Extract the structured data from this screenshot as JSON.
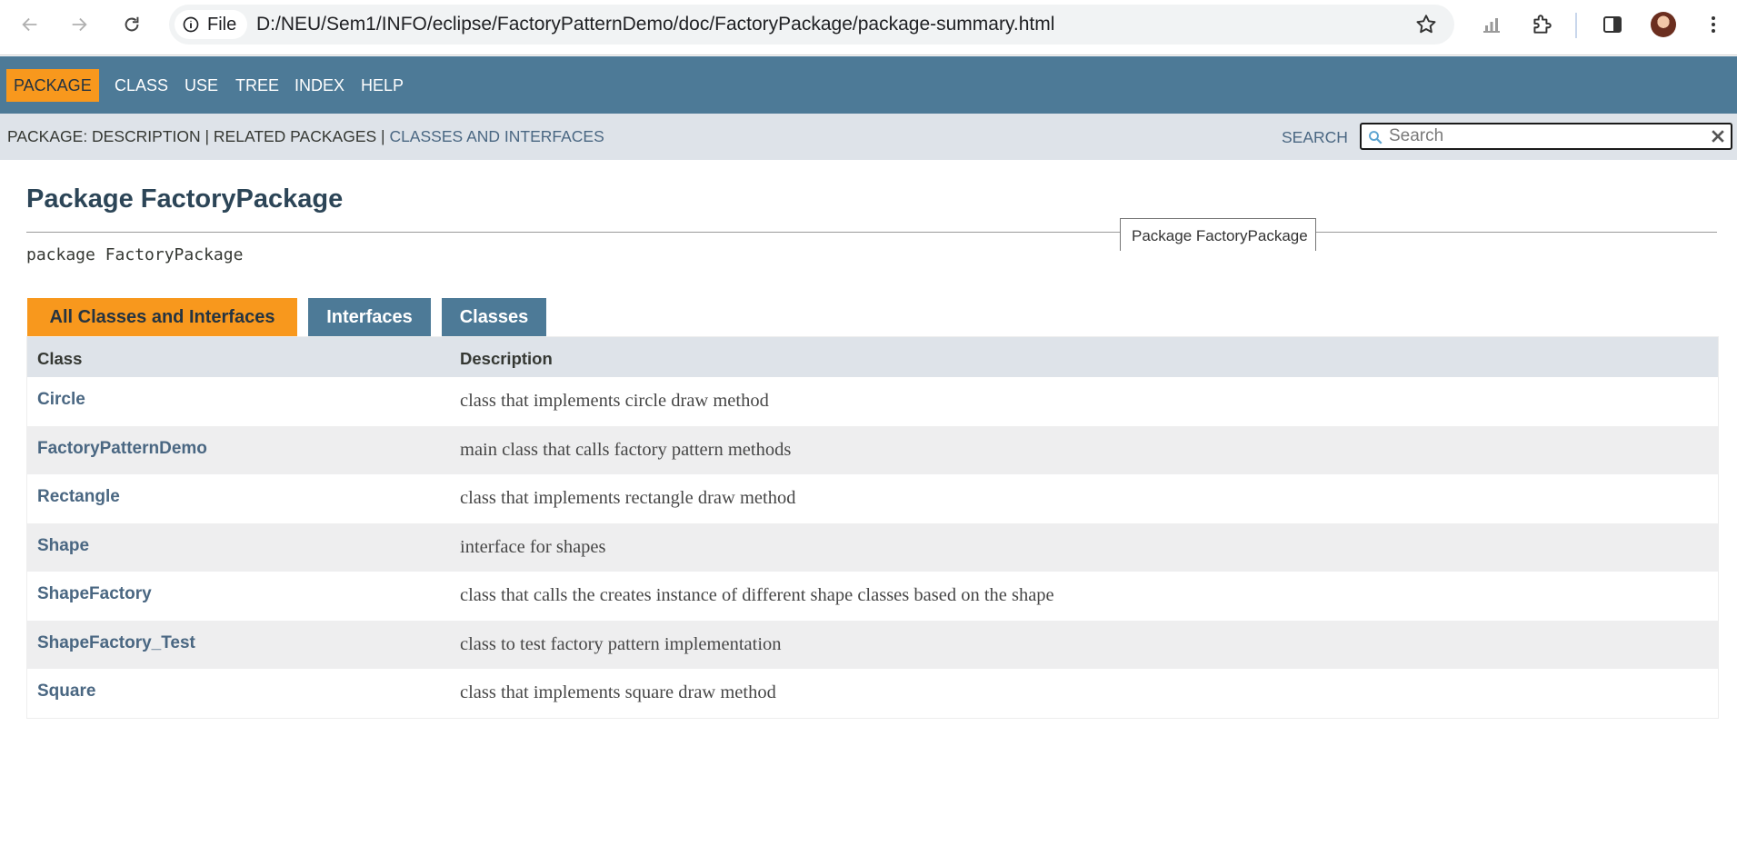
{
  "browser": {
    "file_chip": "File",
    "url": "D:/NEU/Sem1/INFO/eclipse/FactoryPatternDemo/doc/FactoryPackage/package-summary.html",
    "icons": [
      "back-icon",
      "forward-icon",
      "reload-icon",
      "info-icon",
      "star-icon",
      "chart-icon",
      "extensions-icon",
      "sidebar-icon",
      "avatar",
      "menu-icon"
    ]
  },
  "top_nav": {
    "items": [
      "PACKAGE",
      "CLASS",
      "USE",
      "TREE",
      "INDEX",
      "HELP"
    ],
    "active": "PACKAGE"
  },
  "sub_nav": {
    "prefix": "PACKAGE: DESCRIPTION | RELATED PACKAGES | ",
    "link": "CLASSES AND INTERFACES",
    "search_label": "SEARCH",
    "search_placeholder": "Search"
  },
  "page": {
    "title": "Package FactoryPackage",
    "declaration": "package FactoryPackage",
    "tooltip": "Package FactoryPackage"
  },
  "tabs": [
    "All Classes and Interfaces",
    "Interfaces",
    "Classes"
  ],
  "table": {
    "headers": [
      "Class",
      "Description"
    ],
    "rows": [
      {
        "name": "Circle",
        "description": "class that implements circle draw method"
      },
      {
        "name": "FactoryPatternDemo",
        "description": "main class that calls factory pattern methods"
      },
      {
        "name": "Rectangle",
        "description": "class that implements rectangle draw method"
      },
      {
        "name": "Shape",
        "description": "interface for shapes"
      },
      {
        "name": "ShapeFactory",
        "description": "class that calls the creates instance of different shape classes based on the shape"
      },
      {
        "name": "ShapeFactory_Test",
        "description": "class to test factory pattern implementation"
      },
      {
        "name": "Square",
        "description": "class that implements square draw method"
      }
    ]
  },
  "colors": {
    "nav": "#4d7a97",
    "accent": "#f8981d",
    "subnav": "#dee3e9",
    "link": "#4a6782"
  }
}
